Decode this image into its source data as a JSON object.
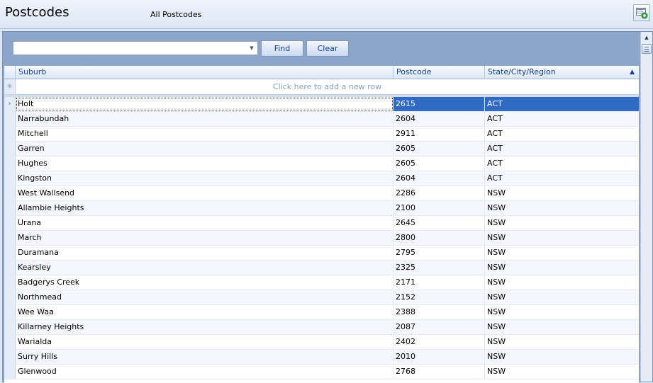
{
  "header": {
    "title": "Postcodes",
    "subtitle": "All Postcodes",
    "corner_icon": "window-restore-icon"
  },
  "search": {
    "combo_value": "",
    "find_label": "Find",
    "clear_label": "Clear"
  },
  "grid": {
    "columns": {
      "suburb": "Suburb",
      "postcode": "Postcode",
      "state": "State/City/Region"
    },
    "sorted_column": "state",
    "sort_direction": "ascending",
    "new_row_text": "Click here to add a new row",
    "selected_index": 0,
    "rows": [
      {
        "suburb": "Holt",
        "postcode": "2615",
        "state": "ACT"
      },
      {
        "suburb": "Narrabundah",
        "postcode": "2604",
        "state": "ACT"
      },
      {
        "suburb": "Mitchell",
        "postcode": "2911",
        "state": "ACT"
      },
      {
        "suburb": "Garren",
        "postcode": "2605",
        "state": "ACT"
      },
      {
        "suburb": "Hughes",
        "postcode": "2605",
        "state": "ACT"
      },
      {
        "suburb": "Kingston",
        "postcode": "2604",
        "state": "ACT"
      },
      {
        "suburb": "West Wallsend",
        "postcode": "2286",
        "state": "NSW"
      },
      {
        "suburb": "Allambie Heights",
        "postcode": "2100",
        "state": "NSW"
      },
      {
        "suburb": "Urana",
        "postcode": "2645",
        "state": "NSW"
      },
      {
        "suburb": "March",
        "postcode": "2800",
        "state": "NSW"
      },
      {
        "suburb": "Duramana",
        "postcode": "2795",
        "state": "NSW"
      },
      {
        "suburb": "Kearsley",
        "postcode": "2325",
        "state": "NSW"
      },
      {
        "suburb": "Badgerys Creek",
        "postcode": "2171",
        "state": "NSW"
      },
      {
        "suburb": "Northmead",
        "postcode": "2152",
        "state": "NSW"
      },
      {
        "suburb": "Wee Waa",
        "postcode": "2388",
        "state": "NSW"
      },
      {
        "suburb": "Killarney Heights",
        "postcode": "2087",
        "state": "NSW"
      },
      {
        "suburb": "Warialda",
        "postcode": "2402",
        "state": "NSW"
      },
      {
        "suburb": "Surry Hills",
        "postcode": "2010",
        "state": "NSW"
      },
      {
        "suburb": "Glenwood",
        "postcode": "2768",
        "state": "NSW"
      }
    ]
  }
}
